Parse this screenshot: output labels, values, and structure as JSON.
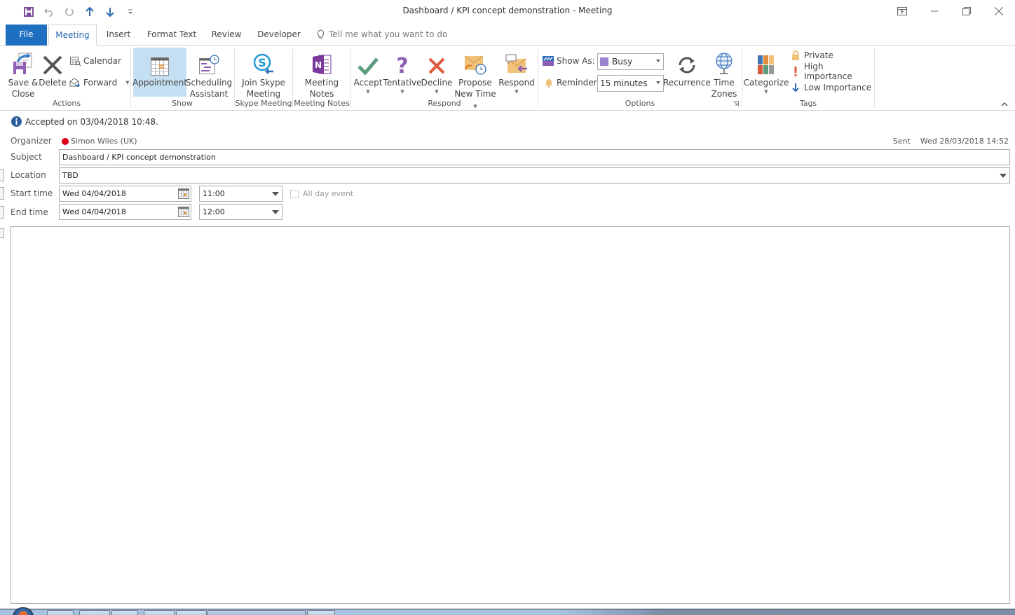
{
  "window": {
    "title": "Dashboard / KPI concept demonstration  -  Meeting",
    "quick_access": [
      "save-icon",
      "undo-icon",
      "redo-icon",
      "previous-item-icon",
      "next-item-icon",
      "customize-qat-icon"
    ],
    "controls": [
      "ribbon-display-options-icon",
      "minimize-icon",
      "restore-icon",
      "close-icon"
    ]
  },
  "tabs": {
    "file": "File",
    "items": [
      "Meeting",
      "Insert",
      "Format Text",
      "Review",
      "Developer"
    ],
    "active": "Meeting",
    "tell_me_placeholder": "Tell me what you want to do"
  },
  "ribbon": {
    "actions": {
      "label": "Actions",
      "save_close": [
        "Save &",
        "Close"
      ],
      "delete": "Delete",
      "calendar": "Calendar",
      "forward": "Forward"
    },
    "show": {
      "label": "Show",
      "appointment": "Appointment",
      "scheduling": [
        "Scheduling",
        "Assistant"
      ]
    },
    "skype": {
      "label": "Skype Meeting",
      "join": [
        "Join Skype",
        "Meeting"
      ]
    },
    "notes": {
      "label": "Meeting Notes",
      "meeting_notes": [
        "Meeting",
        "Notes"
      ]
    },
    "respond": {
      "label": "Respond",
      "accept": "Accept",
      "tentative": "Tentative",
      "decline": "Decline",
      "propose": [
        "Propose",
        "New Time"
      ],
      "respond": "Respond"
    },
    "options": {
      "label": "Options",
      "show_as_label": "Show As:",
      "show_as_value": "Busy",
      "show_as_color": "#9b84cf",
      "reminder_label": "Reminder:",
      "reminder_value": "15 minutes",
      "recurrence": "Recurrence",
      "time_zones": [
        "Time",
        "Zones"
      ]
    },
    "tags": {
      "label": "Tags",
      "categorize": "Categorize",
      "private": "Private",
      "high": "High Importance",
      "low": "Low Importance"
    }
  },
  "form": {
    "info": "Accepted on 03/04/2018 10:48.",
    "organizer_label": "Organizer",
    "organizer": "Simon Wiles (UK)",
    "organizer_status_color": "#e0001b",
    "sent_label": "Sent",
    "sent_value": "Wed 28/03/2018 14:52",
    "subject_label": "Subject",
    "subject": "Dashboard / KPI concept demonstration",
    "location_label": "Location",
    "location": "TBD",
    "start_label": "Start time",
    "start_date": "Wed 04/04/2018",
    "start_time": "11:00",
    "all_day_label": "All day event",
    "all_day_checked": false,
    "end_label": "End time",
    "end_date": "Wed 04/04/2018",
    "end_time": "12:00",
    "body": ""
  },
  "colors": {
    "accent": "#1e6fc0",
    "selected_button": "#c5dff2"
  }
}
